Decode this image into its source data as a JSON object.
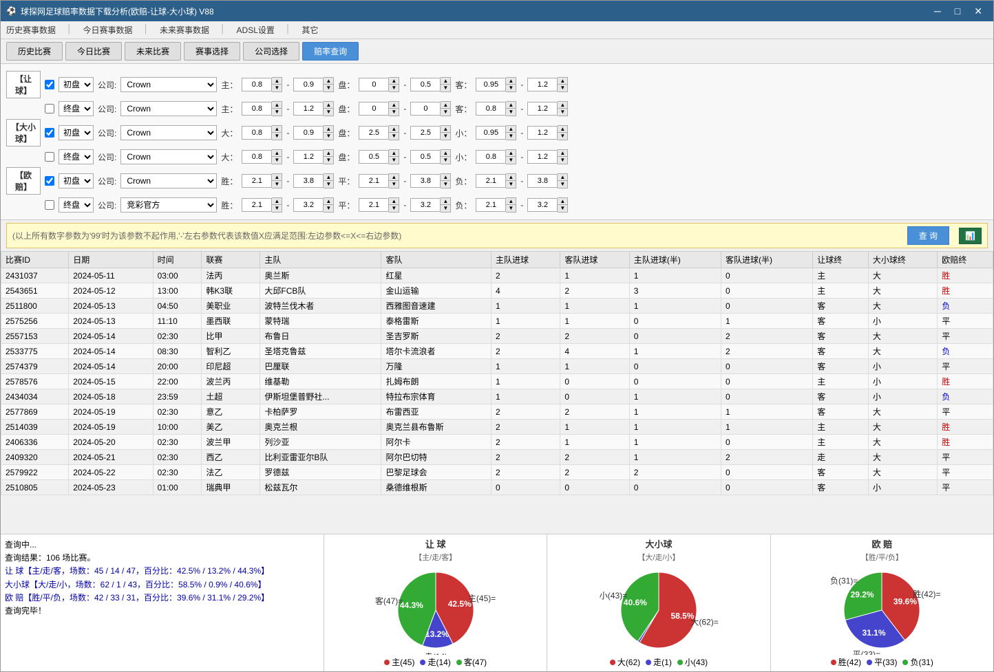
{
  "window": {
    "title": "球探网足球赔率数据下载分析(欧赔-让球-大小球) V88",
    "icon": "🏆"
  },
  "menu": {
    "items": [
      "历史赛事数据",
      "今日赛事数据",
      "未来赛事数据",
      "ADSL设置",
      "其它"
    ]
  },
  "toolbar": {
    "tabs": [
      "历史比赛",
      "今日比赛",
      "未来比赛",
      "赛事选择",
      "公司选择",
      "赔率查询"
    ]
  },
  "params": {
    "rangzhu_label": "【让 球】",
    "daxiao_label": "【大小球】",
    "oupei_label": "【欧赔】",
    "rows": [
      {
        "id": "rz-chu",
        "checked": true,
        "type": "初盘",
        "company": "Crown",
        "label1": "主：",
        "v1a": "0.8",
        "v1b": "0.9",
        "pan_label": "盘：",
        "p1a": "0",
        "p1b": "0.5",
        "label2": "客：",
        "v2a": "0.95",
        "v2b": "1.2"
      },
      {
        "id": "rz-zhong",
        "checked": false,
        "type": "终盘",
        "company": "Crown",
        "label1": "主：",
        "v1a": "0.8",
        "v1b": "1.2",
        "pan_label": "盘：",
        "p1a": "0",
        "p1b": "0",
        "label2": "客：",
        "v2a": "0.8",
        "v2b": "1.2"
      },
      {
        "id": "dx-chu",
        "checked": true,
        "type": "初盘",
        "company": "Crown",
        "label1": "大：",
        "v1a": "0.8",
        "v1b": "0.9",
        "pan_label": "盘：",
        "p1a": "2.5",
        "p1b": "2.5",
        "label2": "小：",
        "v2a": "0.95",
        "v2b": "1.2"
      },
      {
        "id": "dx-zhong",
        "checked": false,
        "type": "终盘",
        "company": "Crown",
        "label1": "大：",
        "v1a": "0.8",
        "v1b": "1.2",
        "pan_label": "盘：",
        "p1a": "0.5",
        "p1b": "0.5",
        "label2": "小：",
        "v2a": "0.8",
        "v2b": "1.2"
      },
      {
        "id": "op-chu",
        "checked": true,
        "type": "初盘",
        "company": "Crown",
        "label1": "胜：",
        "v1a": "2.1",
        "v1b": "3.8",
        "pan_label": "平：",
        "p1a": "2.1",
        "p1b": "3.8",
        "label2": "负：",
        "v2a": "2.1",
        "v2b": "3.8"
      },
      {
        "id": "op-zhong",
        "checked": false,
        "type": "终盘",
        "company": "竞彩官方",
        "label1": "胜：",
        "v1a": "2.1",
        "v1b": "3.2",
        "pan_label": "平：",
        "p1a": "2.1",
        "p1b": "3.2",
        "label2": "负：",
        "v2a": "2.1",
        "v2b": "3.2"
      }
    ]
  },
  "query": {
    "hint": "(以上所有数字参数为'99'时为该参数不起作用,'-'左右参数代表该数值X应满足范围:左边参数<=X<=右边参数)",
    "btn_label": "查 询",
    "excel_icon": "📊"
  },
  "table": {
    "columns": [
      "比赛ID",
      "日期",
      "时间",
      "联赛",
      "主队",
      "客队",
      "主队进球",
      "客队进球",
      "主队进球(半)",
      "客队进球(半)",
      "让球终",
      "大小球终",
      "欧赔终"
    ],
    "rows": [
      [
        "2431037",
        "2024-05-11",
        "03:00",
        "法丙",
        "奥兰斯",
        "红星",
        "2",
        "1",
        "1",
        "0",
        "主",
        "大",
        "胜"
      ],
      [
        "2543651",
        "2024-05-12",
        "13:00",
        "韩K3联",
        "大邱FCB队",
        "金山运输",
        "4",
        "2",
        "3",
        "0",
        "主",
        "大",
        "胜"
      ],
      [
        "2511800",
        "2024-05-13",
        "04:50",
        "美职业",
        "波特兰伐木者",
        "西雅图音速建",
        "1",
        "1",
        "1",
        "0",
        "客",
        "大",
        "负"
      ],
      [
        "2575256",
        "2024-05-13",
        "11:10",
        "墨西联",
        "蒙特瑞",
        "泰格雷斯",
        "1",
        "1",
        "0",
        "1",
        "客",
        "小",
        "平"
      ],
      [
        "2557153",
        "2024-05-14",
        "02:30",
        "比甲",
        "布鲁日",
        "圣吉罗斯",
        "2",
        "2",
        "0",
        "2",
        "客",
        "大",
        "平"
      ],
      [
        "2533775",
        "2024-05-14",
        "08:30",
        "智利乙",
        "圣塔克鲁兹",
        "塔尔卡流浪者",
        "2",
        "4",
        "1",
        "2",
        "客",
        "大",
        "负"
      ],
      [
        "2574379",
        "2024-05-14",
        "20:00",
        "印尼超",
        "巴厘联",
        "万隆",
        "1",
        "1",
        "0",
        "0",
        "客",
        "小",
        "平"
      ],
      [
        "2578576",
        "2024-05-15",
        "22:00",
        "波兰丙",
        "维基勒",
        "扎姆布朗",
        "1",
        "0",
        "0",
        "0",
        "主",
        "小",
        "胜"
      ],
      [
        "2434034",
        "2024-05-18",
        "23:59",
        "土超",
        "伊斯坦堡普野社...",
        "特拉布宗体育",
        "1",
        "0",
        "1",
        "0",
        "客",
        "小",
        "负"
      ],
      [
        "2577869",
        "2024-05-19",
        "02:30",
        "意乙",
        "卡柏萨罗",
        "布雷西亚",
        "2",
        "2",
        "1",
        "1",
        "客",
        "大",
        "平"
      ],
      [
        "2514039",
        "2024-05-19",
        "10:00",
        "美乙",
        "奥克兰根",
        "奥克兰县布鲁斯",
        "2",
        "1",
        "1",
        "1",
        "主",
        "大",
        "胜"
      ],
      [
        "2406336",
        "2024-05-20",
        "02:30",
        "波兰甲",
        "列沙亚",
        "阿尔卡",
        "2",
        "1",
        "1",
        "0",
        "主",
        "大",
        "胜"
      ],
      [
        "2409320",
        "2024-05-21",
        "02:30",
        "西乙",
        "比利亚雷亚尔B队",
        "阿尔巴切特",
        "2",
        "2",
        "1",
        "2",
        "走",
        "大",
        "平"
      ],
      [
        "2579922",
        "2024-05-22",
        "02:30",
        "法乙",
        "罗德兹",
        "巴黎足球会",
        "2",
        "2",
        "2",
        "0",
        "客",
        "大",
        "平"
      ],
      [
        "2510805",
        "2024-05-23",
        "01:00",
        "瑞典甲",
        "松兹瓦尔",
        "桑德维根斯",
        "0",
        "0",
        "0",
        "0",
        "客",
        "小",
        "平"
      ]
    ]
  },
  "log": {
    "lines": [
      "查询中...",
      "查询结果：106 场比赛。",
      "让 球【主/走/客，场数：45 / 14 / 47，百分比：42.5% / 13.2% / 44.3%】",
      "大小球【大/走/小，场数：62 / 1 / 43，百分比：58.5% / 0.9% / 40.6%】",
      "欧 赔【胜/平/负，场数：42 / 33 / 31，百分比：39.6% / 31.1% / 29.2%】",
      "查询完毕！"
    ]
  },
  "charts": {
    "rangzhu": {
      "title": "让 球",
      "subtitle": "【主/走/客】",
      "slices": [
        {
          "label": "主(45)",
          "pct": 42.5,
          "color": "#cc3333"
        },
        {
          "label": "走(14)",
          "pct": 13.2,
          "color": "#4444cc"
        },
        {
          "label": "客(47)",
          "pct": 44.3,
          "color": "#33aa33"
        }
      ],
      "legend": [
        "主(45)",
        "走(14)",
        "客(47)"
      ],
      "legend_pcts": [
        "42.50%",
        "13.20%",
        "44.30%"
      ],
      "colors": [
        "#cc3333",
        "#4444cc",
        "#33aa33"
      ]
    },
    "daxiao": {
      "title": "大小球",
      "subtitle": "【大/走/小】",
      "slices": [
        {
          "label": "大(62)",
          "pct": 58.5,
          "color": "#cc3333"
        },
        {
          "label": "走(1)",
          "pct": 0.9,
          "color": "#4444cc"
        },
        {
          "label": "小(43)",
          "pct": 40.6,
          "color": "#33aa33"
        }
      ],
      "legend": [
        "大(62)",
        "走(1)",
        "小(43)"
      ],
      "legend_pcts": [
        "58.50%",
        "0.90%",
        "40.60%"
      ],
      "colors": [
        "#cc3333",
        "#4444cc",
        "#33aa33"
      ]
    },
    "oupei": {
      "title": "欧 赔",
      "subtitle": "【胜/平/负】",
      "slices": [
        {
          "label": "胜(42)",
          "pct": 39.6,
          "color": "#cc3333"
        },
        {
          "label": "平(33)",
          "pct": 31.1,
          "color": "#4444cc"
        },
        {
          "label": "负(31)",
          "pct": 29.2,
          "color": "#33aa33"
        }
      ],
      "legend": [
        "胜(42)",
        "平(33)",
        "负(31)"
      ],
      "legend_pcts": [
        "39.64%",
        "31.13%",
        "29.23%"
      ],
      "colors": [
        "#cc3333",
        "#4444cc",
        "#33aa33"
      ]
    }
  }
}
